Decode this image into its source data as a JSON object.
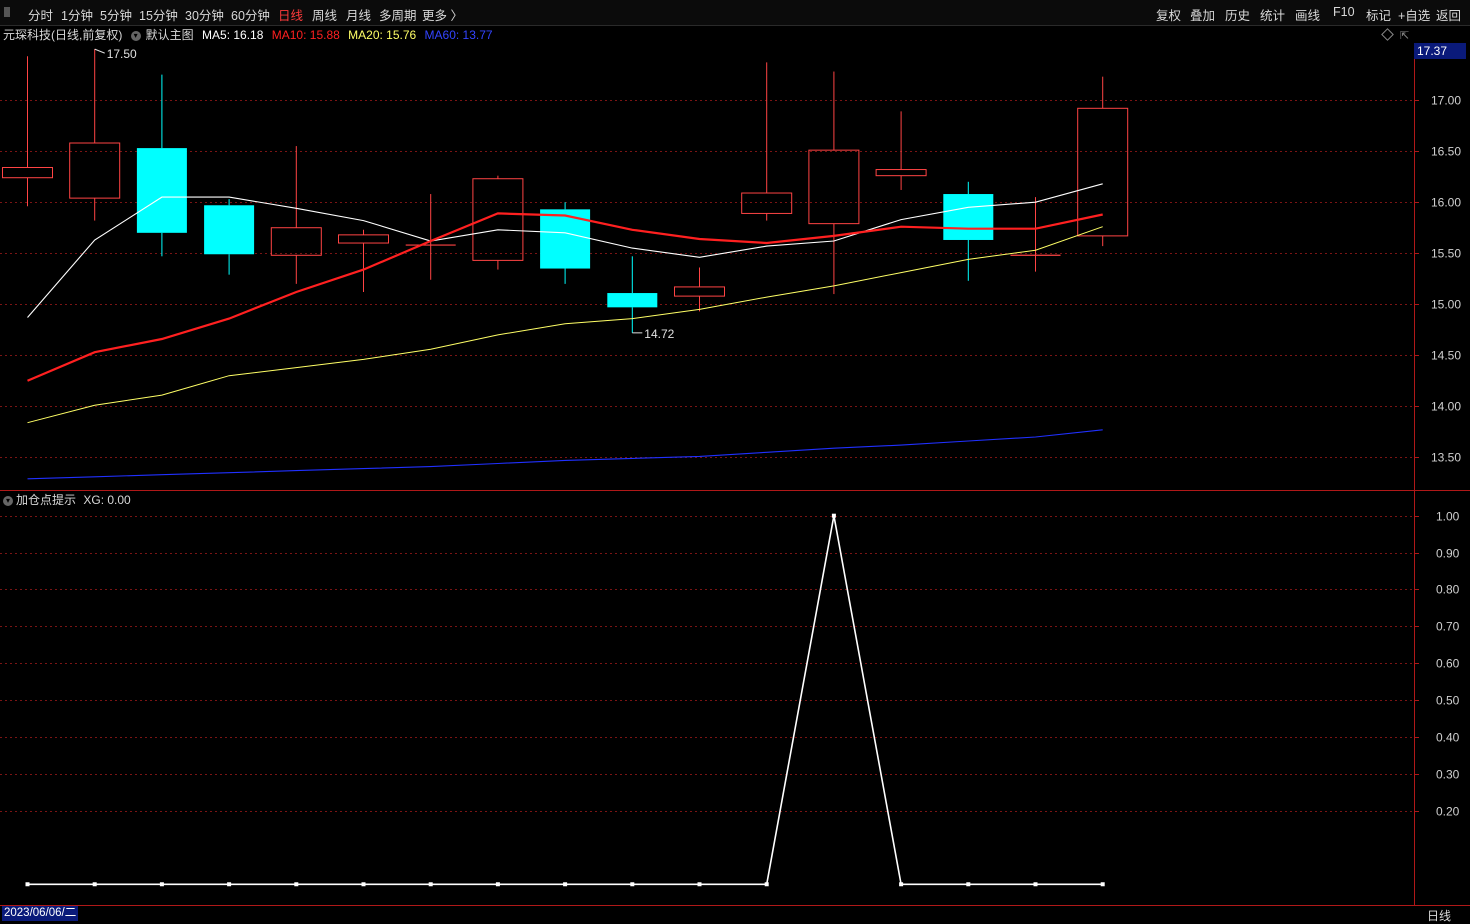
{
  "toolbar": {
    "periods": [
      "分时",
      "1分钟",
      "5分钟",
      "15分钟",
      "30分钟",
      "60分钟",
      "日线",
      "周线",
      "月线",
      "多周期",
      "更多 〉"
    ],
    "active_period": "日线",
    "tools": [
      "复权",
      "叠加",
      "历史",
      "统计",
      "画线",
      "F10",
      "标记",
      "+自选",
      "返回"
    ]
  },
  "main_panel": {
    "stock_name": "元琛科技(日线,前复权)",
    "template": "默认主图",
    "ma5": "MA5: 16.18",
    "ma10": "MA10: 15.88",
    "ma20": "MA20: 15.76",
    "ma60": "MA60: 13.77",
    "current_price_tag": "17.37",
    "high_label": "17.50",
    "low_label": "14.72",
    "colors": {
      "up": "#ff4444",
      "down": "#00ffff",
      "ma5": "#ffffff",
      "ma10": "#ff2020",
      "ma20": "#ffff66",
      "ma60": "#2030ff"
    }
  },
  "indicator_panel": {
    "name": "加仓点提示",
    "xg": "XG: 0.00"
  },
  "footer": {
    "date": "2023/06/06/二",
    "period": "日线"
  },
  "chart_data": [
    {
      "type": "candlestick",
      "y_axis_ticks": [
        "17.00",
        "16.50",
        "16.00",
        "15.50",
        "15.00",
        "14.50",
        "14.00",
        "13.50"
      ],
      "ylim": [
        13.2,
        17.55
      ],
      "candles": [
        {
          "open": 16.24,
          "close": 16.34,
          "high": 17.43,
          "low": 15.96
        },
        {
          "open": 16.04,
          "close": 16.58,
          "high": 17.5,
          "low": 15.82
        },
        {
          "open": 16.53,
          "close": 15.7,
          "high": 17.25,
          "low": 15.47
        },
        {
          "open": 15.97,
          "close": 15.49,
          "high": 16.03,
          "low": 15.29
        },
        {
          "open": 15.48,
          "close": 15.75,
          "high": 16.55,
          "low": 15.2
        },
        {
          "open": 15.6,
          "close": 15.68,
          "high": 15.73,
          "low": 15.12
        },
        {
          "open": 15.58,
          "close": 15.58,
          "high": 16.08,
          "low": 15.24
        },
        {
          "open": 15.43,
          "close": 16.23,
          "high": 16.26,
          "low": 15.34
        },
        {
          "open": 15.93,
          "close": 15.35,
          "high": 16.0,
          "low": 15.2
        },
        {
          "open": 15.11,
          "close": 14.97,
          "high": 15.47,
          "low": 14.72
        },
        {
          "open": 15.08,
          "close": 15.17,
          "high": 15.36,
          "low": 14.93
        },
        {
          "open": 15.89,
          "close": 16.09,
          "high": 17.37,
          "low": 15.82
        },
        {
          "open": 15.79,
          "close": 16.51,
          "high": 17.28,
          "low": 15.1
        },
        {
          "open": 16.26,
          "close": 16.32,
          "high": 16.89,
          "low": 16.12
        },
        {
          "open": 16.08,
          "close": 15.63,
          "high": 16.2,
          "low": 15.23
        },
        {
          "open": 15.48,
          "close": 15.48,
          "high": 16.05,
          "low": 15.32
        },
        {
          "open": 15.67,
          "close": 16.92,
          "high": 17.23,
          "low": 15.57
        }
      ],
      "series": [
        {
          "name": "MA5",
          "values": [
            14.87,
            15.63,
            16.05,
            16.05,
            15.94,
            15.82,
            15.62,
            15.73,
            15.7,
            15.55,
            15.46,
            15.57,
            15.62,
            15.83,
            15.95,
            16.0,
            16.18
          ]
        },
        {
          "name": "MA10",
          "values": [
            14.25,
            14.53,
            14.66,
            14.86,
            15.12,
            15.34,
            15.62,
            15.89,
            15.87,
            15.73,
            15.64,
            15.6,
            15.67,
            15.76,
            15.74,
            15.74,
            15.88
          ]
        },
        {
          "name": "MA20",
          "values": [
            13.84,
            14.01,
            14.11,
            14.3,
            14.38,
            14.46,
            14.56,
            14.7,
            14.81,
            14.86,
            14.95,
            15.07,
            15.18,
            15.31,
            15.44,
            15.53,
            15.76
          ]
        },
        {
          "name": "MA60",
          "values": [
            13.29,
            13.31,
            13.33,
            13.35,
            13.37,
            13.39,
            13.41,
            13.44,
            13.47,
            13.49,
            13.51,
            13.55,
            13.59,
            13.62,
            13.66,
            13.7,
            13.77
          ]
        }
      ]
    },
    {
      "type": "line",
      "title": "加仓点提示",
      "y_axis_ticks": [
        "1.00",
        "0.90",
        "0.80",
        "0.70",
        "0.60",
        "0.50",
        "0.40",
        "0.30",
        "0.20"
      ],
      "ylim": [
        -0.04,
        1.01
      ],
      "series": [
        {
          "name": "XG",
          "values": [
            0,
            0,
            0,
            0,
            0,
            0,
            0,
            0,
            0,
            0,
            0,
            0,
            1,
            0,
            0,
            0,
            0
          ]
        }
      ]
    }
  ]
}
